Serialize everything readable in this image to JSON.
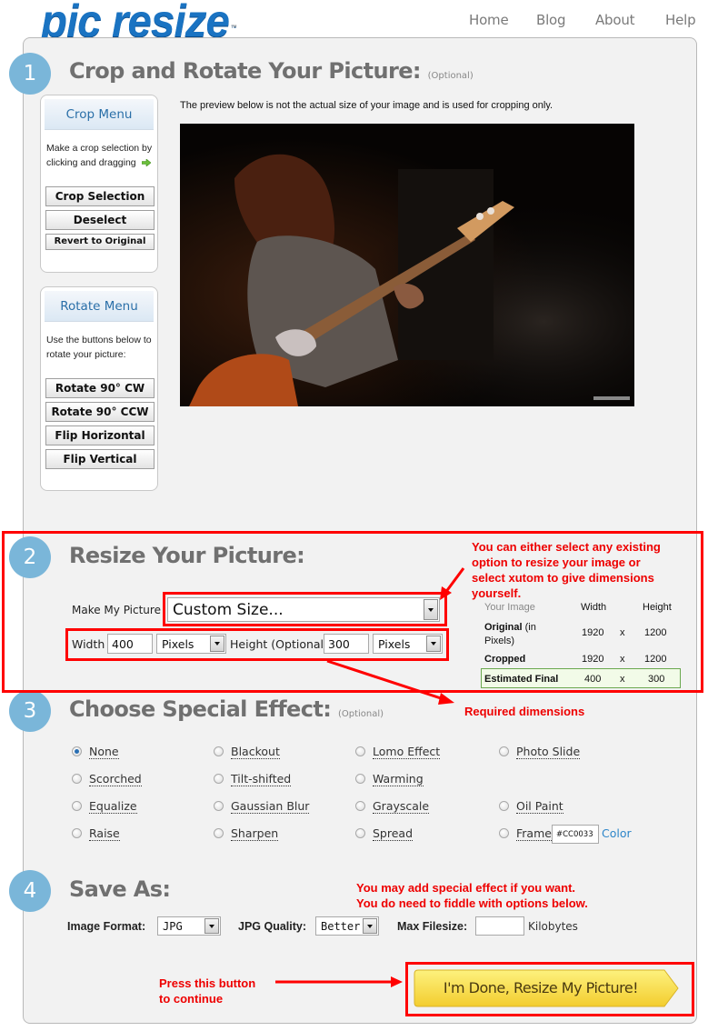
{
  "header": {
    "logo": "pic resize",
    "logo_tm": "™",
    "nav": [
      "Home",
      "Blog",
      "About",
      "Help"
    ]
  },
  "step1": {
    "number": "1",
    "title": "Crop and Rotate Your Picture:",
    "optional": "(Optional)",
    "preview_note": "The preview below is not the actual size of your image and is used for cropping only.",
    "crop_menu": {
      "title": "Crop Menu",
      "text": "Make a crop selection by clicking and dragging",
      "buttons": [
        "Crop Selection",
        "Deselect",
        "Revert to Original"
      ]
    },
    "rotate_menu": {
      "title": "Rotate Menu",
      "text": "Use the buttons below to rotate your picture:",
      "buttons": [
        "Rotate 90° CW",
        "Rotate 90° CCW",
        "Flip Horizontal",
        "Flip Vertical"
      ]
    }
  },
  "step2": {
    "number": "2",
    "title": "Resize Your Picture:",
    "make_label": "Make My Picture",
    "size_select": "Custom Size...",
    "width_label": "Width",
    "width_value": "400",
    "width_unit": "Pixels",
    "height_label": "Height (Optional)",
    "height_value": "300",
    "height_unit": "Pixels",
    "table": {
      "headers": [
        "Your Image",
        "Width",
        "",
        "Height"
      ],
      "rows": [
        {
          "label": "Original",
          "sub": " (in",
          "sub2": "Pixels)",
          "width": "1920",
          "x": "x",
          "height": "1200"
        },
        {
          "label": "Cropped",
          "width": "1920",
          "x": "x",
          "height": "1200"
        },
        {
          "label": "Estimated Final",
          "width": "400",
          "x": "x",
          "height": "300"
        }
      ]
    }
  },
  "step3": {
    "number": "3",
    "title": "Choose Special Effect:",
    "optional": "(Optional)",
    "effects": [
      {
        "label": "None",
        "checked": true
      },
      {
        "label": "Blackout"
      },
      {
        "label": "Lomo Effect"
      },
      {
        "label": "Photo Slide"
      },
      {
        "label": "Scorched"
      },
      {
        "label": "Tilt-shifted"
      },
      {
        "label": "Warming"
      },
      {
        "label": "Equalize"
      },
      {
        "label": "Gaussian Blur"
      },
      {
        "label": "Grayscale"
      },
      {
        "label": "Oil Paint"
      },
      {
        "label": "Raise"
      },
      {
        "label": "Sharpen"
      },
      {
        "label": "Spread"
      },
      {
        "label": "Frame"
      }
    ],
    "frame_color_value": "#CC0033",
    "color_link": "Color"
  },
  "step4": {
    "number": "4",
    "title": "Save As:",
    "format_label": "Image Format:",
    "format_value": "JPG",
    "quality_label": "JPG Quality:",
    "quality_value": "Better",
    "filesize_label": "Max Filesize:",
    "filesize_value": "",
    "filesize_unit": "Kilobytes",
    "done_button": "I'm Done, Resize My Picture!"
  },
  "annotations": {
    "resize_note": [
      "You can either select any existing",
      "option to resize your image or",
      "select xutom to give dimensions",
      "yourself."
    ],
    "required": "Required dimensions",
    "effect_note": [
      "You may add special effect if you want.",
      "You do need to fiddle with options below."
    ],
    "press_note": [
      "Press this button",
      "to continue"
    ]
  },
  "colors": {
    "accent": "#7ab6d9",
    "annotation_red": "#ff0000",
    "brand_blue": "#1a73c2",
    "button_yellow": "#f7d84a"
  }
}
